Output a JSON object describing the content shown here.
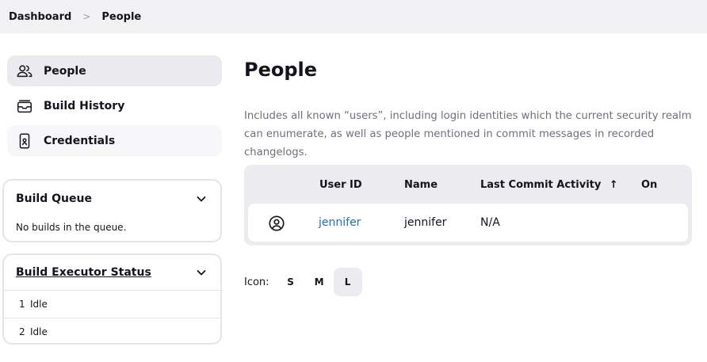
{
  "breadcrumb": {
    "items": [
      "Dashboard",
      "People"
    ],
    "separator": ">"
  },
  "sidebar": {
    "items": [
      {
        "label": "People",
        "icon": "people-icon"
      },
      {
        "label": "Build History",
        "icon": "history-icon"
      },
      {
        "label": "Credentials",
        "icon": "credentials-icon"
      }
    ]
  },
  "build_queue": {
    "title": "Build Queue",
    "empty_text": "No builds in the queue."
  },
  "executor_status": {
    "title": "Build Executor Status",
    "executors": [
      {
        "num": "1",
        "state": "Idle"
      },
      {
        "num": "2",
        "state": "Idle"
      }
    ]
  },
  "main": {
    "title": "People",
    "description": "Includes all known “users”, including login identities which the current security realm can enumerate, as well as people mentioned in commit messages in recorded changelogs.",
    "table": {
      "headers": {
        "user_id": "User ID",
        "name": "Name",
        "last_commit": "Last Commit Activity",
        "sort_arrow": "↑",
        "on": "On"
      },
      "rows": [
        {
          "user_id": "jennifer",
          "name": "jennifer",
          "last_commit": "N/A",
          "on": ""
        }
      ]
    },
    "icon_size": {
      "label": "Icon:",
      "options": [
        "S",
        "M",
        "L"
      ],
      "selected": "L"
    }
  },
  "colors": {
    "link": "#1f6fc1",
    "active_bg": "#ebebef",
    "border": "#e4e4ea"
  }
}
